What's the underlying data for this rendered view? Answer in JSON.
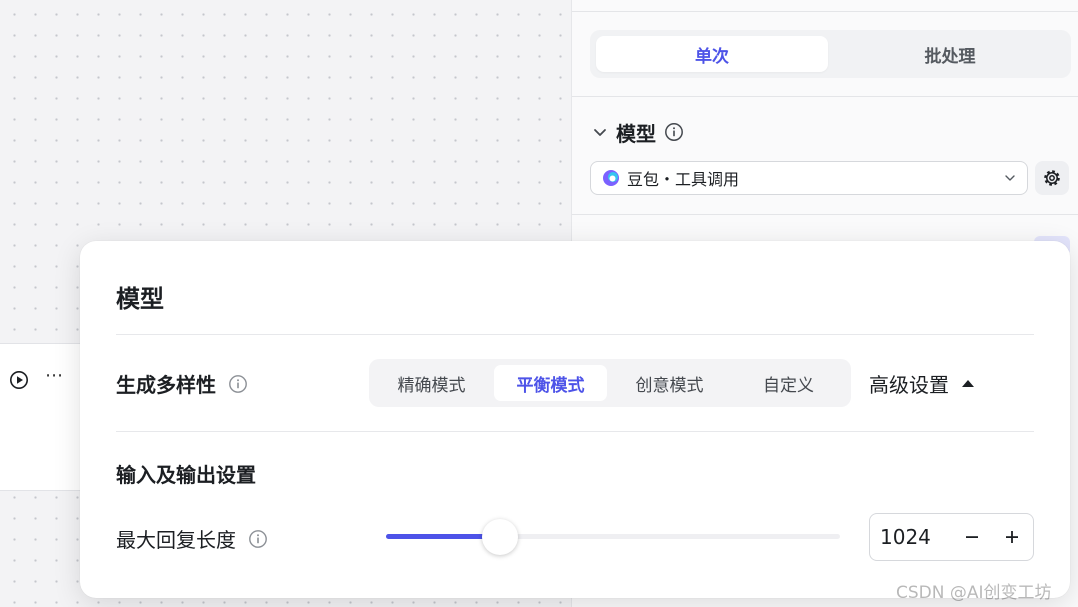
{
  "right_panel": {
    "tabs": [
      {
        "label": "单次",
        "active": true
      },
      {
        "label": "批处理",
        "active": false
      }
    ],
    "model_section_title": "模型",
    "model_select_value": "豆包・工具调用"
  },
  "popup": {
    "title": "模型",
    "diversity_label": "生成多样性",
    "modes": [
      {
        "label": "精确模式",
        "active": false
      },
      {
        "label": "平衡模式",
        "active": true
      },
      {
        "label": "创意模式",
        "active": false
      },
      {
        "label": "自定义",
        "active": false
      }
    ],
    "advanced_label": "高级设置",
    "io_section_title": "输入及输出设置",
    "max_length_label": "最大回复长度",
    "max_length_value": "1024",
    "max_length_slider_fraction": 0.25
  },
  "watermark": "CSDN @AI创变工坊",
  "colors": {
    "accent": "#4d53e8",
    "text": "#1c1f23",
    "muted": "#555a60"
  },
  "icons": {
    "run": "play-circle-icon",
    "more": "more-dots-icon",
    "collapse": "chevron-down-icon",
    "info": "info-circle-icon",
    "settings": "gear-icon",
    "expand_up": "caret-up-icon",
    "minus": "minus-icon",
    "plus": "plus-icon"
  }
}
